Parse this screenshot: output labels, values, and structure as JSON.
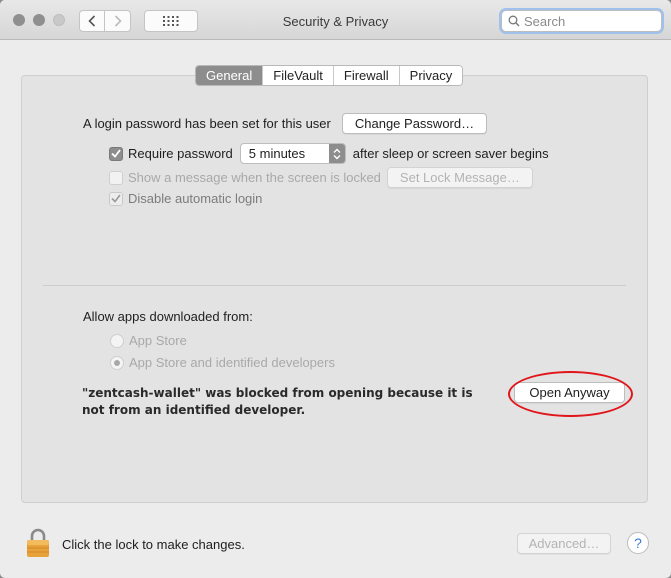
{
  "window": {
    "title": "Security & Privacy",
    "search": {
      "placeholder": "Search"
    }
  },
  "tabs": [
    {
      "label": "General",
      "active": true
    },
    {
      "label": "FileVault",
      "active": false
    },
    {
      "label": "Firewall",
      "active": false
    },
    {
      "label": "Privacy",
      "active": false
    }
  ],
  "general": {
    "login_text": "A login password has been set for this user",
    "change_password_button": "Change Password…",
    "require_password": {
      "label": "Require password",
      "checked": true
    },
    "require_password_delay": "5 minutes",
    "after_sleep_text": "after sleep or screen saver begins",
    "show_message": {
      "label": "Show a message when the screen is locked",
      "checked": false
    },
    "set_lock_message_button": "Set Lock Message…",
    "disable_auto_login": {
      "label": "Disable automatic login",
      "checked": true
    }
  },
  "allow_apps": {
    "heading": "Allow apps downloaded from:",
    "options": [
      {
        "label": "App Store",
        "selected": false
      },
      {
        "label": "App Store and identified developers",
        "selected": true
      }
    ],
    "blocked_message_line1": "\"zentcash-wallet\" was blocked from opening because it is",
    "blocked_message_line2": "not from an identified developer.",
    "open_anyway_button": "Open Anyway"
  },
  "footer": {
    "lock_text": "Click the lock to make changes.",
    "advanced_button": "Advanced…",
    "help_button": "?"
  },
  "colors": {
    "selected_tab": "#8d8d8d",
    "highlight_circle": "#e0161b",
    "lock": "#e9a13a"
  }
}
